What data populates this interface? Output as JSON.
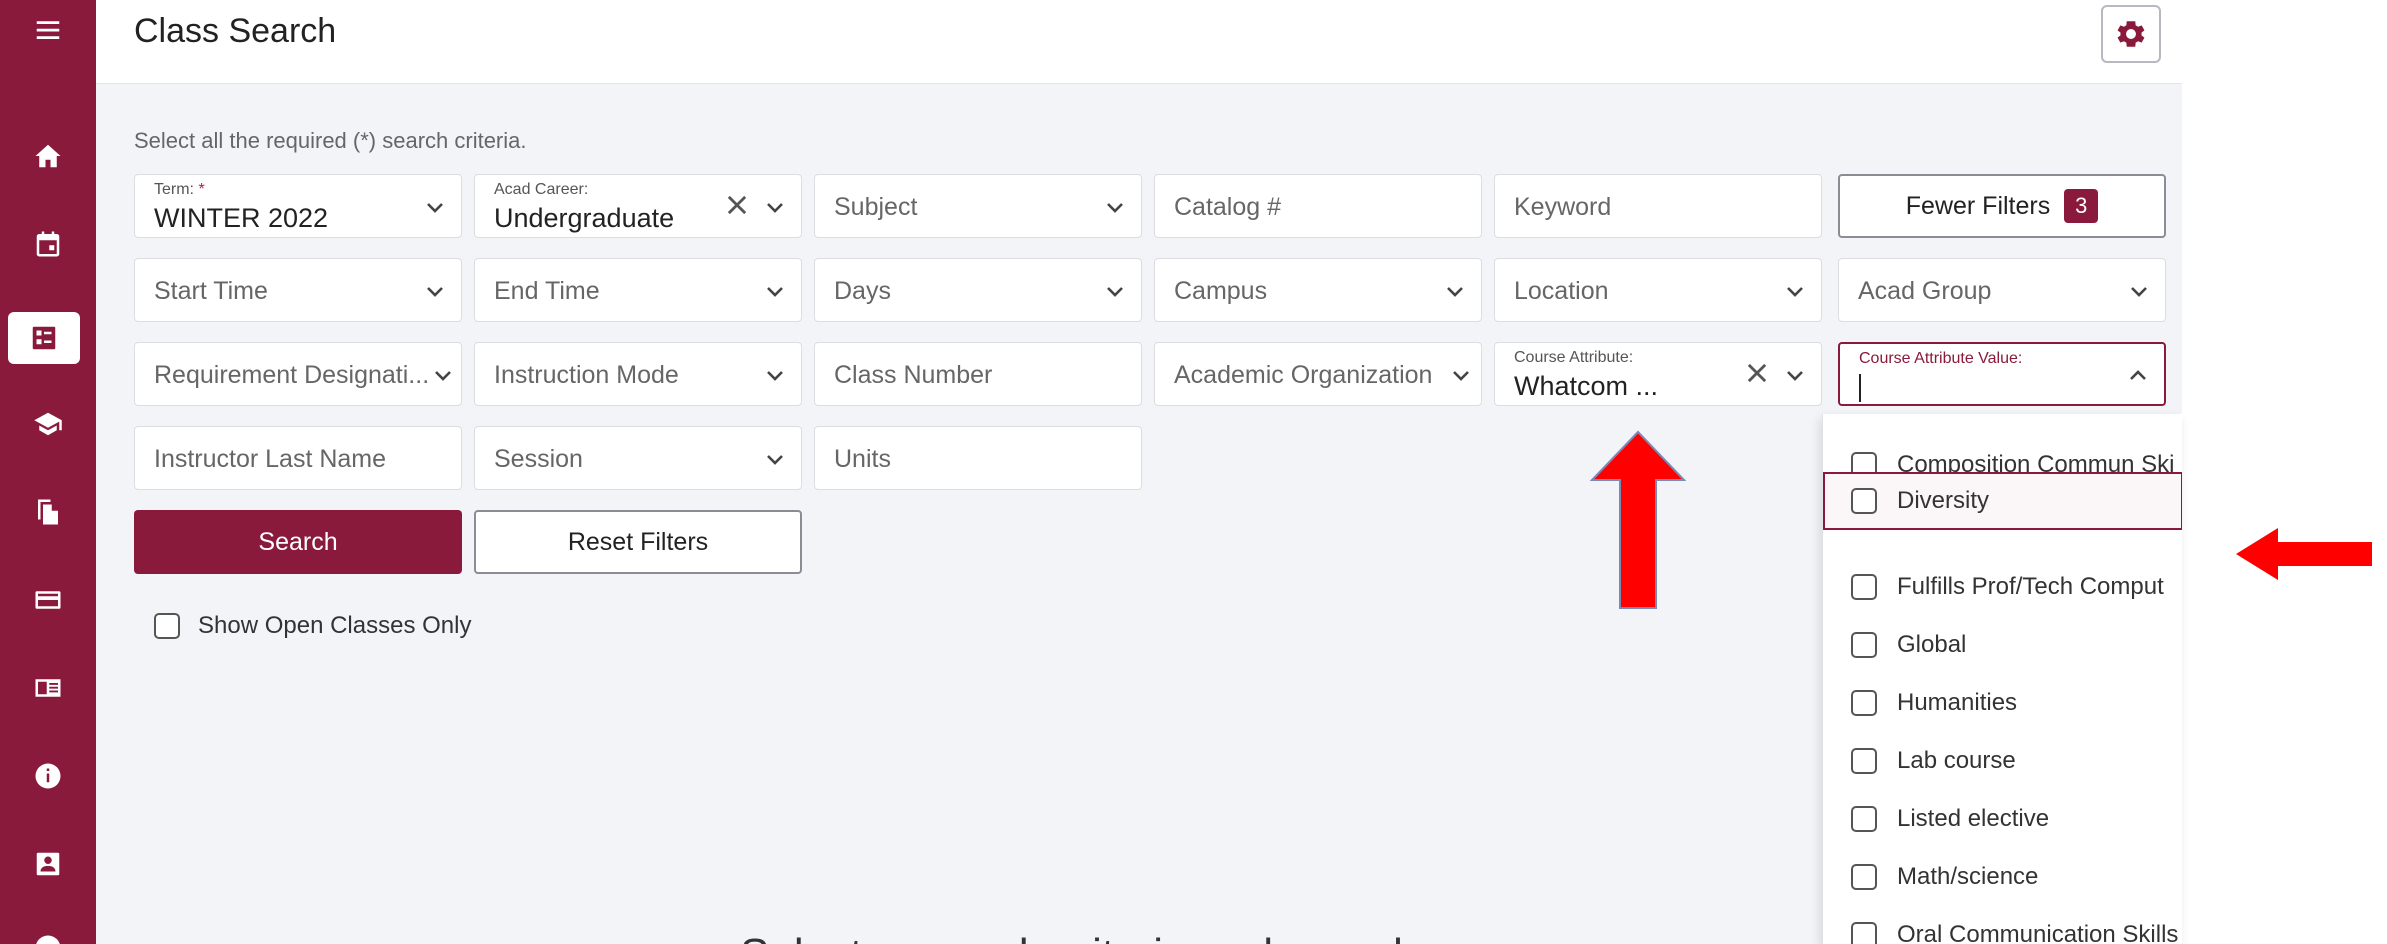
{
  "title": "Class Search",
  "instructions": "Select all the required (*) search criteria.",
  "colors": {
    "brand": "#8a1a3c",
    "annotation_arrow": "#ff0000"
  },
  "sidebar": {
    "icons": [
      "menu-icon",
      "home-icon",
      "calendar-icon",
      "class-search-icon",
      "graduation-cap-icon",
      "documents-icon",
      "card-icon",
      "catalog-icon",
      "info-icon",
      "profile-icon",
      "more-icon"
    ],
    "active": "class-search-icon"
  },
  "filters": {
    "term": {
      "label": "Term:",
      "required_mark": "*",
      "value": "WINTER 2022"
    },
    "acad_career": {
      "label": "Acad Career:",
      "value": "Undergraduate"
    },
    "subject": {
      "placeholder": "Subject"
    },
    "catalog": {
      "placeholder": "Catalog #"
    },
    "keyword": {
      "placeholder": "Keyword"
    },
    "start_time": {
      "placeholder": "Start Time"
    },
    "end_time": {
      "placeholder": "End Time"
    },
    "days": {
      "placeholder": "Days"
    },
    "campus": {
      "placeholder": "Campus"
    },
    "location": {
      "placeholder": "Location"
    },
    "acad_group": {
      "placeholder": "Acad Group"
    },
    "requirement": {
      "placeholder": "Requirement Designati..."
    },
    "instruction_mode": {
      "placeholder": "Instruction Mode"
    },
    "class_number": {
      "placeholder": "Class Number"
    },
    "academic_org": {
      "placeholder": "Academic Organization"
    },
    "course_attribute": {
      "label": "Course Attribute:",
      "value": "Whatcom ..."
    },
    "course_attribute_value": {
      "label": "Course Attribute Value:",
      "value": ""
    },
    "instructor": {
      "placeholder": "Instructor Last Name"
    },
    "session": {
      "placeholder": "Session"
    },
    "units": {
      "placeholder": "Units"
    }
  },
  "fewer_filters": {
    "label": "Fewer Filters",
    "count": "3"
  },
  "buttons": {
    "search": "Search",
    "reset": "Reset Filters"
  },
  "open_only": {
    "label": "Show Open Classes Only",
    "checked": false
  },
  "attribute_options": [
    "Composition Commun Ski",
    "Diversity",
    "Fulfills Prof/Tech Comput",
    "Global",
    "Humanities",
    "Lab course",
    "Listed elective",
    "Math/science",
    "Oral Communication Skills"
  ],
  "highlighted_option": "Diversity",
  "bottom_text": "Select a search criteria and search"
}
